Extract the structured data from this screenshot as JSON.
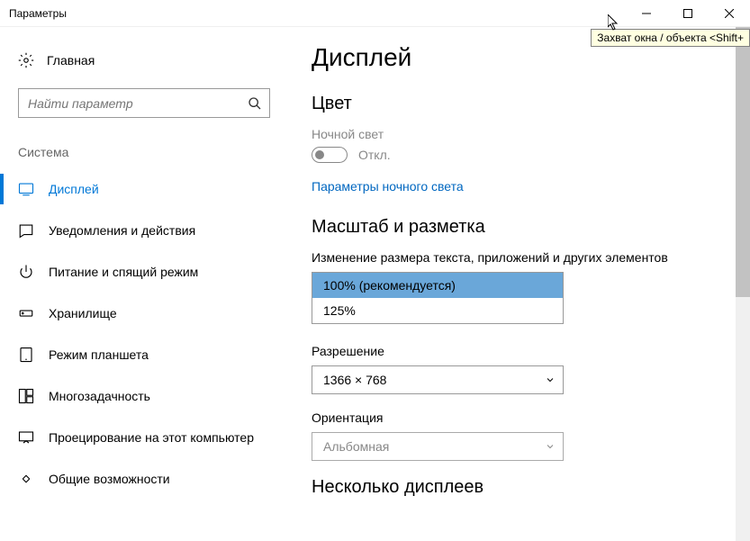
{
  "titlebar": {
    "title": "Параметры"
  },
  "tooltip": "Захват окна / объекта <Shift+",
  "sidebar": {
    "home": "Главная",
    "search_placeholder": "Найти параметр",
    "section": "Система",
    "items": [
      {
        "label": "Дисплей",
        "icon": "display",
        "active": true
      },
      {
        "label": "Уведомления и действия",
        "icon": "notif"
      },
      {
        "label": "Питание и спящий режим",
        "icon": "power"
      },
      {
        "label": "Хранилище",
        "icon": "storage"
      },
      {
        "label": "Режим планшета",
        "icon": "tablet"
      },
      {
        "label": "Многозадачность",
        "icon": "multi"
      },
      {
        "label": "Проецирование на этот компьютер",
        "icon": "project"
      },
      {
        "label": "Общие возможности",
        "icon": "shared"
      }
    ]
  },
  "content": {
    "page_title": "Дисплей",
    "color_heading": "Цвет",
    "night_light_label": "Ночной свет",
    "toggle_state": "Откл.",
    "night_light_link": "Параметры ночного света",
    "scale_heading": "Масштаб и разметка",
    "text_size_label": "Изменение размера текста, приложений и других элементов",
    "scale_options": [
      {
        "label": "100% (рекомендуется)",
        "selected": true
      },
      {
        "label": "125%",
        "selected": false
      }
    ],
    "resolution_label": "Разрешение",
    "resolution_value": "1366 × 768",
    "orientation_label": "Ориентация",
    "orientation_value": "Альбомная",
    "multi_display_heading": "Несколько дисплеев"
  }
}
